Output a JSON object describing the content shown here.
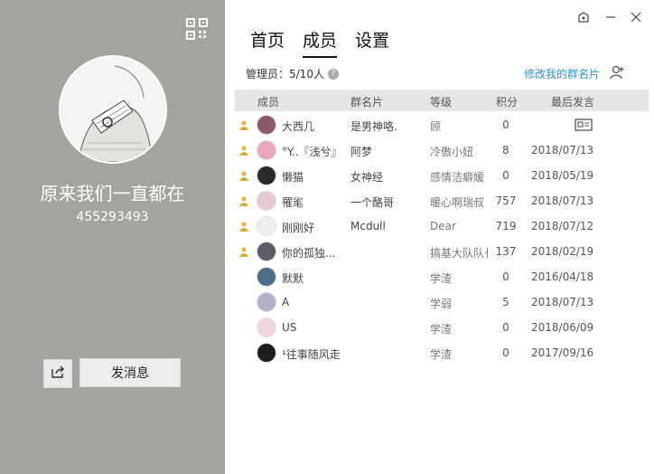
{
  "group": {
    "name": "原来我们一直都在",
    "id": "455293493",
    "send_message_label": "发消息"
  },
  "tabs": [
    {
      "label": "首页",
      "active": false
    },
    {
      "label": "成员",
      "active": true
    },
    {
      "label": "设置",
      "active": false
    }
  ],
  "admin": {
    "label": "管理员：5/10人",
    "help": "?"
  },
  "edit_card_label": "修改我的群名片",
  "columns": {
    "member": "成员",
    "card": "群名片",
    "level": "等级",
    "score": "积分",
    "last_post": "最后发言"
  },
  "members": [
    {
      "admin": true,
      "name": "大西几",
      "card": "是男神咯.",
      "level": "顾",
      "score": "0",
      "date": "",
      "avatar_color": "#8a5a6a",
      "show_card_icon": true
    },
    {
      "admin": true,
      "name": "°Y..『浅兮』",
      "card": "阿梦",
      "level": "冷傲小妞",
      "score": "8",
      "date": "2018/07/13",
      "avatar_color": "#e8a6b8",
      "show_card_icon": false
    },
    {
      "admin": true,
      "name": "懒猫",
      "card": "女神经",
      "level": "感情洁癖媛",
      "score": "0",
      "date": "2018/05/19",
      "avatar_color": "#2b2b2b",
      "show_card_icon": false
    },
    {
      "admin": true,
      "name": "罹毟",
      "card": "一个酪哥",
      "level": "暖心啊瑞叔",
      "score": "757",
      "date": "2018/07/13",
      "avatar_color": "#e7c9d6",
      "show_card_icon": false
    },
    {
      "admin": true,
      "name": "刚刚好",
      "card": "Mcdull",
      "level": "Dear",
      "score": "719",
      "date": "2018/07/12",
      "avatar_color": "#f0eef2",
      "show_card_icon": false
    },
    {
      "admin": true,
      "name": "你的孤独...",
      "card": "",
      "level": "搞基大队队长",
      "score": "137",
      "date": "2018/02/19",
      "avatar_color": "#5a5f66",
      "show_card_icon": false
    },
    {
      "admin": false,
      "name": "默默",
      "card": "",
      "level": "学渣",
      "score": "0",
      "date": "2016/04/18",
      "avatar_color": "#4f6d85",
      "show_card_icon": false
    },
    {
      "admin": false,
      "name": "A",
      "card": "",
      "level": "学弱",
      "score": "5",
      "date": "2018/07/13",
      "avatar_color": "#b4aec6",
      "show_card_icon": false
    },
    {
      "admin": false,
      "name": "US",
      "card": "",
      "level": "学渣",
      "score": "0",
      "date": "2018/06/09",
      "avatar_color": "#f0d6d8",
      "show_card_icon": false
    },
    {
      "admin": false,
      "name": "¹往事随风走",
      "card": "",
      "level": "学渣",
      "score": "0",
      "date": "2017/09/16",
      "avatar_color": "#1e1e1e",
      "show_card_icon": false
    }
  ],
  "colors": {
    "left_panel": "#a3a49e",
    "link": "#2a94d6",
    "header_bg": "#e6e6e6",
    "admin_crown": "#f0b040"
  },
  "icons": {
    "qr": "qr-code-icon",
    "share": "share-icon",
    "skin": "skin-icon",
    "minimize": "minimize-icon",
    "close": "close-icon",
    "edit_card": "edit-card-icon",
    "crown": "admin-icon",
    "card": "card-icon"
  }
}
